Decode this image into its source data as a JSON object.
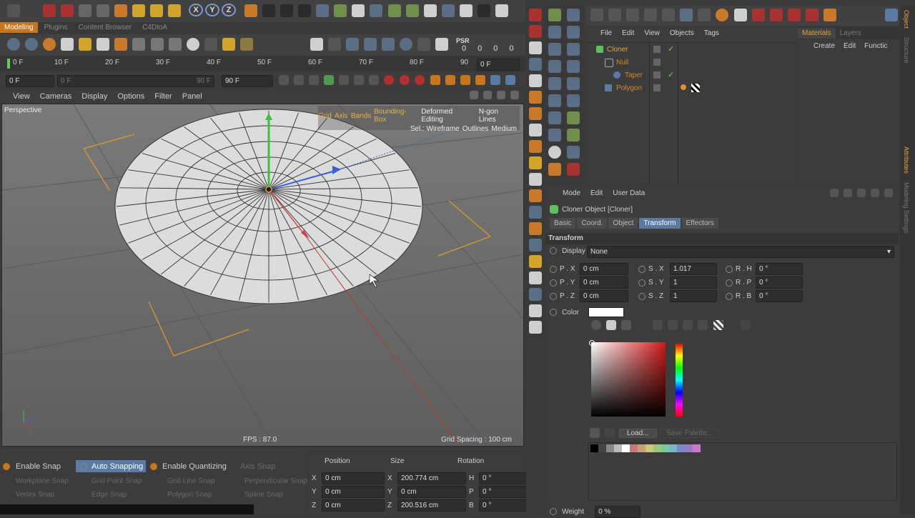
{
  "toolbar_top": {
    "axis_x": "X",
    "axis_y": "Y",
    "axis_z": "Z"
  },
  "layout_tabs": [
    "Modeling",
    "Plugins",
    "Content Browser",
    "C4DtoA"
  ],
  "timeline": {
    "ticks": [
      "0 F",
      "10 F",
      "20 F",
      "30 F",
      "40 F",
      "50 F",
      "60 F",
      "70 F",
      "80 F",
      "90"
    ],
    "current": "0 F",
    "start": "0 F",
    "range_start": "0 F",
    "range_end": "90 F",
    "end": "90 F",
    "psr_label": "PSR",
    "psr_values": [
      "0",
      "0",
      "0",
      "0"
    ]
  },
  "viewport": {
    "menu": [
      "View",
      "Cameras",
      "Display",
      "Options",
      "Filter",
      "Panel"
    ],
    "name": "Perspective",
    "overlay_line1": [
      "Grid",
      "Axis",
      "Bands",
      "Bounding-Box",
      "Deformed Editing",
      "N-gon Lines"
    ],
    "overlay_line2": [
      "Sel.: Wireframe",
      "Outlines",
      "Medium"
    ],
    "fps": "FPS : 87.0",
    "grid_spacing": "Grid Spacing : 100 cm"
  },
  "snap": {
    "enable_snap": "Enable Snap",
    "auto_snapping": "Auto Snapping",
    "enable_quantizing": "Enable Quantizing",
    "axis_snap": "Axis Snap",
    "row2": [
      "Workplane Snap",
      "Grid Point Snap",
      "Grid Line Snap",
      "Perpendicular Snap"
    ],
    "row3": [
      "Vertex Snap",
      "Edge Snap",
      "Polygon Snap",
      "Spline Snap"
    ]
  },
  "coords": {
    "headers": [
      "Position",
      "Size",
      "Rotation"
    ],
    "rows": [
      {
        "axis": "X",
        "pos": "0 cm",
        "size_axis": "X",
        "size": "200.774 cm",
        "rot_axis": "H",
        "rot": "0 °"
      },
      {
        "axis": "Y",
        "pos": "0 cm",
        "size_axis": "Y",
        "size": "0 cm",
        "rot_axis": "P",
        "rot": "0 °"
      },
      {
        "axis": "Z",
        "pos": "0 cm",
        "size_axis": "Z",
        "size": "200.516 cm",
        "rot_axis": "B",
        "rot": "0 °"
      }
    ]
  },
  "objects": {
    "menu": [
      "File",
      "Edit",
      "View",
      "Objects",
      "Tags"
    ],
    "items": [
      {
        "name": "Cloner",
        "color": "#f0a040"
      },
      {
        "name": "Null",
        "color": "#d28a2a"
      },
      {
        "name": "Taper",
        "color": "#d28a2a"
      },
      {
        "name": "Polygon",
        "color": "#d28a2a"
      }
    ]
  },
  "materials": {
    "tabs": [
      "Materials",
      "Layers"
    ],
    "menu": [
      "Create",
      "Edit",
      "Functic"
    ]
  },
  "side_tabs": {
    "right_top": "Object",
    "right_mid": "Structure",
    "right_low1": "Attributes",
    "right_low2": "Modeling Settings"
  },
  "attributes": {
    "menu": [
      "Mode",
      "Edit",
      "User Data"
    ],
    "title": "Cloner Object [Cloner]",
    "tabs": [
      "Basic",
      "Coord.",
      "Object",
      "Transform",
      "Effectors"
    ],
    "section": "Transform",
    "display_label": "Display",
    "display_value": "None",
    "rows": [
      {
        "p_label": "P . X",
        "p": "0 cm",
        "s_label": "S . X",
        "s": "1.017",
        "r_label": "R . H",
        "r": "0 °"
      },
      {
        "p_label": "P . Y",
        "p": "0 cm",
        "s_label": "S . Y",
        "s": "1",
        "r_label": "R . P",
        "r": "0 °"
      },
      {
        "p_label": "P . Z",
        "p": "0 cm",
        "s_label": "S . Z",
        "s": "1",
        "r_label": "R . B",
        "r": "0 °"
      }
    ],
    "color_label": "Color",
    "color_value": "#ffffff",
    "load_button": "Load...",
    "save_palette_button": "Save Palette...",
    "weight_label": "Weight",
    "weight_value": "0 %"
  }
}
